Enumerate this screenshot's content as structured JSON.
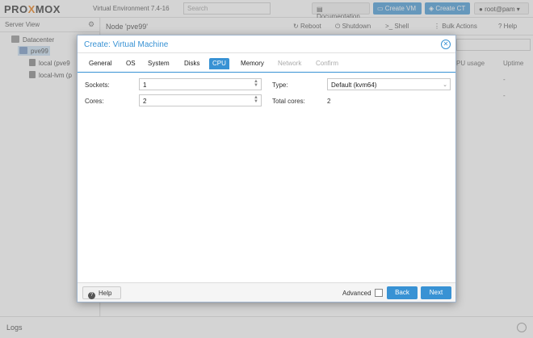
{
  "app": {
    "logo_prefix": "PRO",
    "logo_x": "X",
    "logo_suffix": "MOX",
    "version": "Virtual Environment 7.4-16",
    "search_placeholder": "Search",
    "documentation_label": "Documentation",
    "create_vm_label": "Create VM",
    "create_ct_label": "Create CT",
    "user_label": "root@pam"
  },
  "sidebar": {
    "view_label": "Server View",
    "items": [
      {
        "label": "Datacenter",
        "icon": "datacenter-icon"
      },
      {
        "label": "pve99",
        "icon": "node-icon"
      },
      {
        "label": "local (pve9",
        "icon": "storage-icon"
      },
      {
        "label": "local-lvm (p",
        "icon": "storage-icon"
      }
    ]
  },
  "main": {
    "node_title": "Node 'pve99'",
    "reboot_label": "Reboot",
    "shutdown_label": "Shutdown",
    "shell_label": "Shell",
    "bulk_actions_label": "Bulk Actions",
    "help_label": "Help",
    "col_cpu_usage": "PU usage",
    "col_uptime": "Uptime",
    "cell_dash_1": "-",
    "cell_dash_2": "-"
  },
  "logs": {
    "label": "Logs"
  },
  "modal": {
    "title": "Create: Virtual Machine",
    "tabs": [
      {
        "label": "General",
        "state": "normal"
      },
      {
        "label": "OS",
        "state": "normal"
      },
      {
        "label": "System",
        "state": "normal"
      },
      {
        "label": "Disks",
        "state": "normal"
      },
      {
        "label": "CPU",
        "state": "active"
      },
      {
        "label": "Memory",
        "state": "normal"
      },
      {
        "label": "Network",
        "state": "disabled"
      },
      {
        "label": "Confirm",
        "state": "disabled"
      }
    ],
    "fields": {
      "sockets_label": "Sockets:",
      "sockets_value": "1",
      "cores_label": "Cores:",
      "cores_value": "2",
      "type_label": "Type:",
      "type_value": "Default (kvm64)",
      "total_cores_label": "Total cores:",
      "total_cores_value": "2"
    },
    "footer": {
      "help_label": "Help",
      "advanced_label": "Advanced",
      "back_label": "Back",
      "next_label": "Next"
    }
  },
  "colors": {
    "accent": "#3892d4",
    "logo_x": "#e57000"
  }
}
